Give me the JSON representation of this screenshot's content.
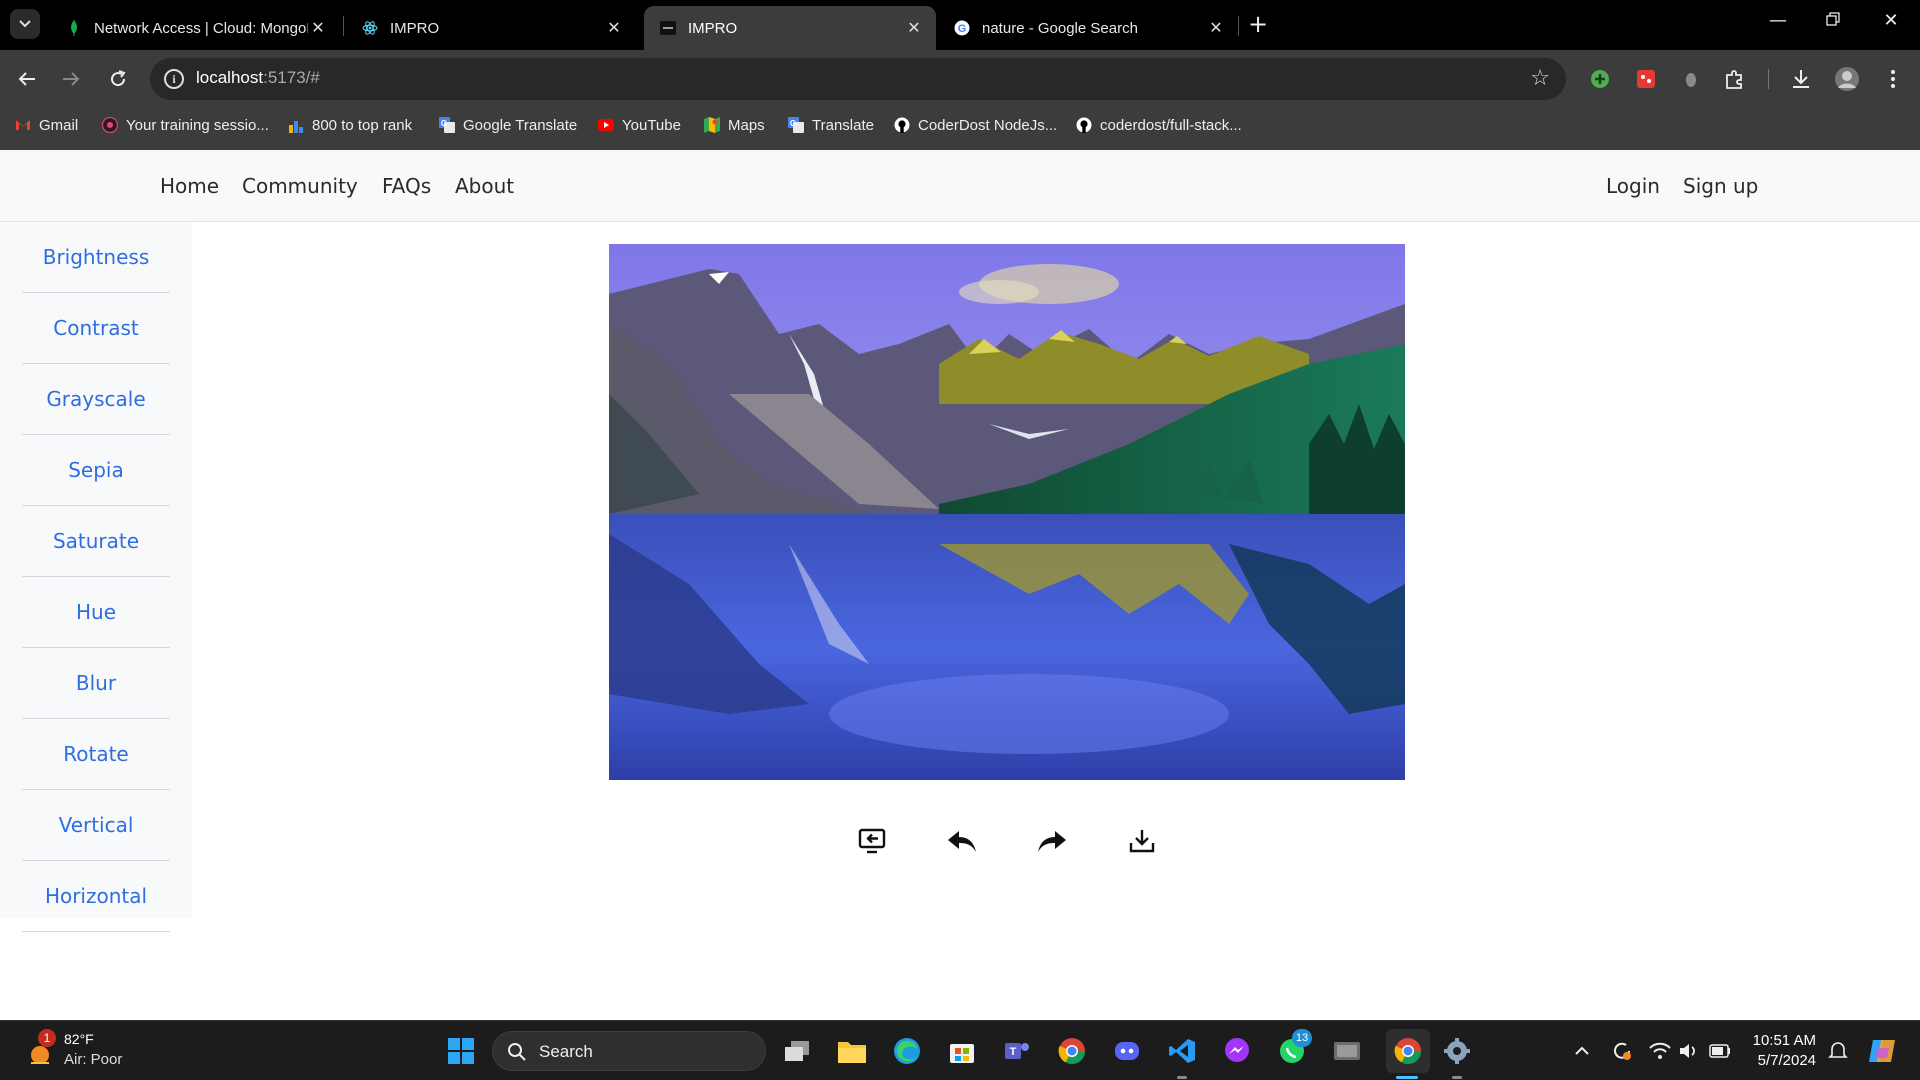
{
  "browser": {
    "tabs": [
      {
        "title": "Network Access | Cloud: MongoDB Cloud",
        "active": false
      },
      {
        "title": "IMPRO",
        "active": false
      },
      {
        "title": "IMPRO",
        "active": true
      },
      {
        "title": "nature - Google Search",
        "active": false
      }
    ],
    "url_host": "localhost",
    "url_rest": ":5173/#",
    "bookmarks": [
      {
        "label": "Gmail"
      },
      {
        "label": "Your training sessio..."
      },
      {
        "label": "800 to top rank"
      },
      {
        "label": "Google Translate"
      },
      {
        "label": "YouTube"
      },
      {
        "label": "Maps"
      },
      {
        "label": "Translate"
      },
      {
        "label": "CoderDost NodeJs..."
      },
      {
        "label": "coderdost/full-stack..."
      }
    ]
  },
  "site": {
    "nav_left": [
      "Home",
      "Community",
      "FAQs",
      "About"
    ],
    "nav_right": [
      "Login",
      "Sign up"
    ],
    "sidebar": [
      "Brightness",
      "Contrast",
      "Grayscale",
      "Sepia",
      "Saturate",
      "Hue",
      "Blur",
      "Rotate",
      "Vertical",
      "Horizontal"
    ],
    "actions": [
      {
        "icon": "reset-icon"
      },
      {
        "icon": "undo-icon"
      },
      {
        "icon": "redo-icon"
      },
      {
        "icon": "download-icon"
      }
    ],
    "accent_color": "#2f6ee0"
  },
  "taskbar": {
    "temperature": "82°F",
    "air_quality": "Air: Poor",
    "weather_badge": "1",
    "search_label": "Search",
    "whatsapp_badge": "13",
    "time": "10:51 AM",
    "date": "5/7/2024"
  }
}
